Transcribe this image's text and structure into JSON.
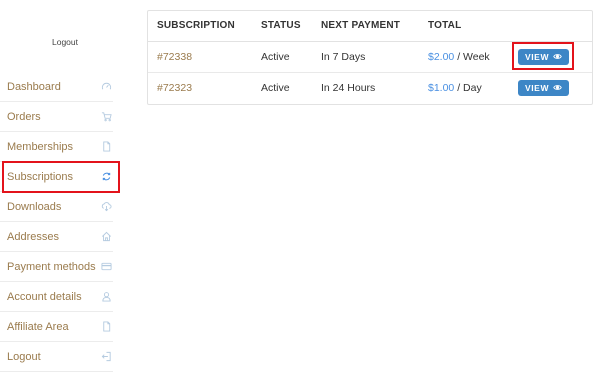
{
  "sidebar": {
    "top_logout": "Logout",
    "items": [
      {
        "label": "Dashboard",
        "icon": "dashboard-gauge-icon"
      },
      {
        "label": "Orders",
        "icon": "cart-icon"
      },
      {
        "label": "Memberships",
        "icon": "document-icon"
      },
      {
        "label": "Subscriptions",
        "icon": "refresh-icon"
      },
      {
        "label": "Downloads",
        "icon": "cloud-download-icon"
      },
      {
        "label": "Addresses",
        "icon": "home-icon"
      },
      {
        "label": "Payment methods",
        "icon": "credit-card-icon"
      },
      {
        "label": "Account details",
        "icon": "user-icon"
      },
      {
        "label": "Affiliate Area",
        "icon": "document-icon"
      },
      {
        "label": "Logout",
        "icon": "logout-icon"
      }
    ]
  },
  "table": {
    "headers": [
      "SUBSCRIPTION",
      "STATUS",
      "NEXT PAYMENT",
      "TOTAL",
      ""
    ],
    "rows": [
      {
        "id": "#72338",
        "status": "Active",
        "next_payment": "In 7 Days",
        "amount": "$2.00",
        "period": " / Week",
        "action": "VIEW"
      },
      {
        "id": "#72323",
        "status": "Active",
        "next_payment": "In 24 Hours",
        "amount": "$1.00",
        "period": " / Day",
        "action": "VIEW"
      }
    ]
  },
  "colors": {
    "link": "#9a7b4d",
    "price": "#4a90e2",
    "button": "#3d86c6",
    "highlight": "#e3131b",
    "icon": "#b5cbe0"
  }
}
